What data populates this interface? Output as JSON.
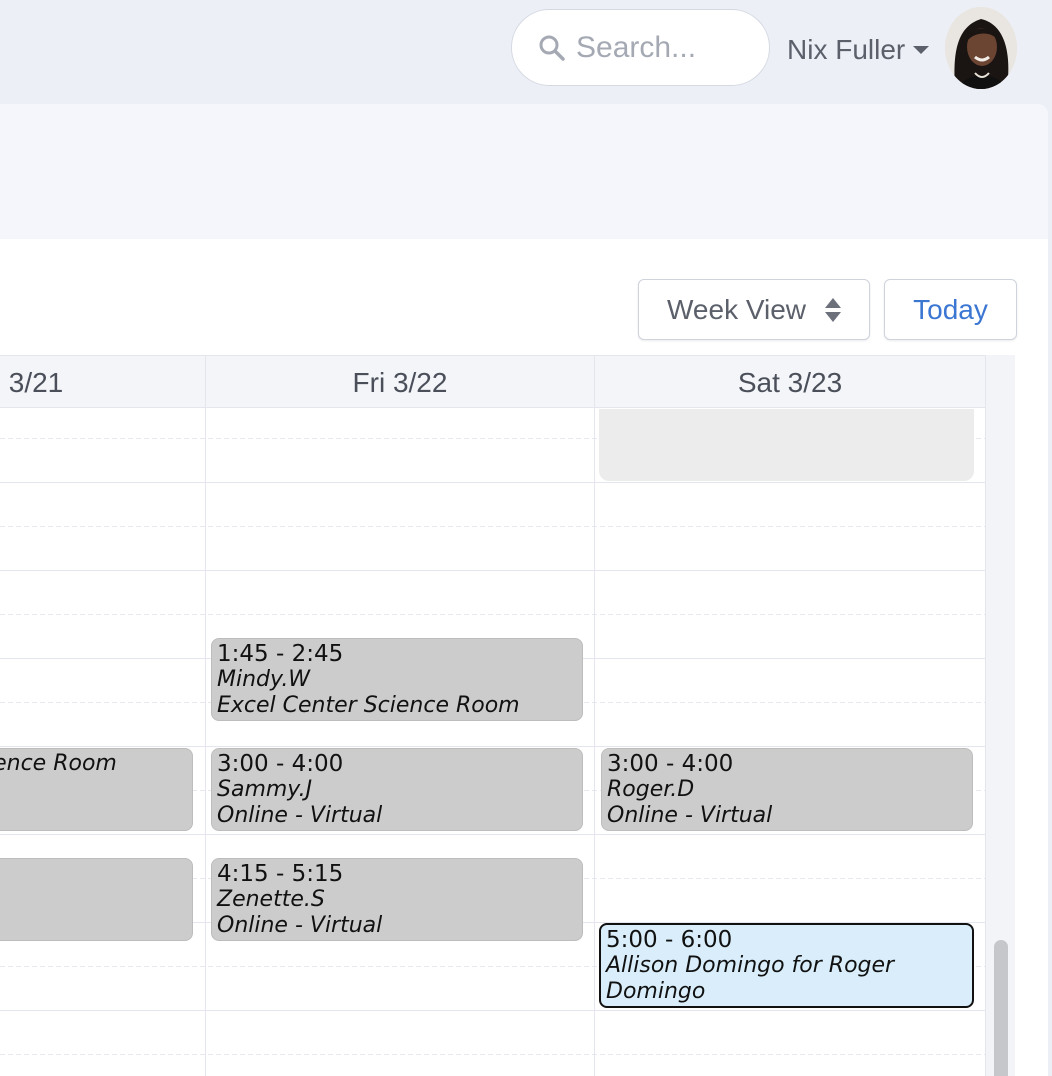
{
  "header": {
    "search_placeholder": "Search...",
    "user_name": "Nix Fuller"
  },
  "toolbar": {
    "view_select": "Week View",
    "today_label": "Today"
  },
  "calendar": {
    "columns": [
      {
        "label": "3/21"
      },
      {
        "label": "Fri 3/22"
      },
      {
        "label": "Sat 3/23"
      }
    ],
    "events": [
      {
        "day": "Fri 3/22",
        "time": "1:45 - 2:45",
        "person": "Mindy.W",
        "location": "Excel Center Science Room"
      },
      {
        "day": "3/21",
        "time": "",
        "person": "",
        "location": "ience Room"
      },
      {
        "day": "Fri 3/22",
        "time": "3:00 - 4:00",
        "person": "Sammy.J",
        "location": "Online - Virtual"
      },
      {
        "day": "Sat 3/23",
        "time": "3:00 - 4:00",
        "person": "Roger.D",
        "location": "Online - Virtual"
      },
      {
        "day": "3/21",
        "time": "",
        "person": "",
        "location": ""
      },
      {
        "day": "Fri 3/22",
        "time": "4:15 - 5:15",
        "person": "Zenette.S",
        "location": "Online - Virtual"
      },
      {
        "day": "Sat 3/23",
        "time": "5:00 - 6:00",
        "person": "Allison Domingo for Roger Domingo",
        "location": ""
      }
    ]
  },
  "colors": {
    "page_bg": "#eceff6",
    "event_bg": "#cccccc",
    "event_highlight_bg": "#d9eefa",
    "accent": "#3b76d2"
  }
}
